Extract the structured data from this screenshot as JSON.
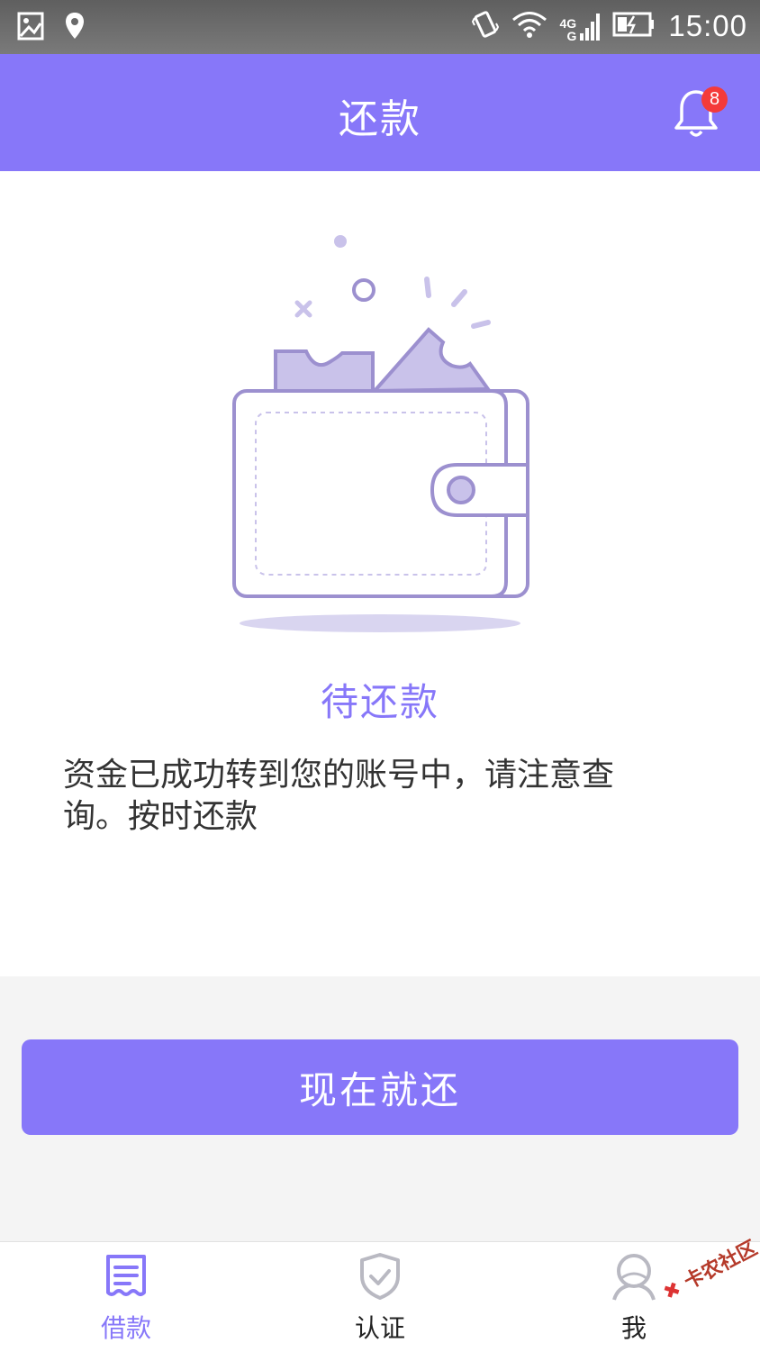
{
  "status_bar": {
    "time": "15:00",
    "network_label_top": "4G",
    "network_label_bottom": "G",
    "icons": [
      "gallery-icon",
      "location-icon",
      "vibrate-icon",
      "wifi-icon",
      "signal-icon",
      "battery-icon"
    ]
  },
  "header": {
    "title": "还款",
    "notification_count": "8"
  },
  "main": {
    "status_title": "待还款",
    "message": "资金已成功转到您的账号中，请注意查询。按时还款"
  },
  "action": {
    "repay_label": "现在就还"
  },
  "bottom_nav": {
    "items": [
      {
        "label": "借款",
        "icon": "loan-list-icon",
        "active": true
      },
      {
        "label": "认证",
        "icon": "shield-check-icon",
        "active": false
      },
      {
        "label": "我",
        "icon": "user-icon",
        "active": false
      }
    ]
  },
  "watermark": {
    "text": "卡农社区"
  },
  "colors": {
    "accent": "#8777f9",
    "accent_dark": "#9c90cf",
    "badge": "#f43a3a",
    "text": "#333333"
  }
}
